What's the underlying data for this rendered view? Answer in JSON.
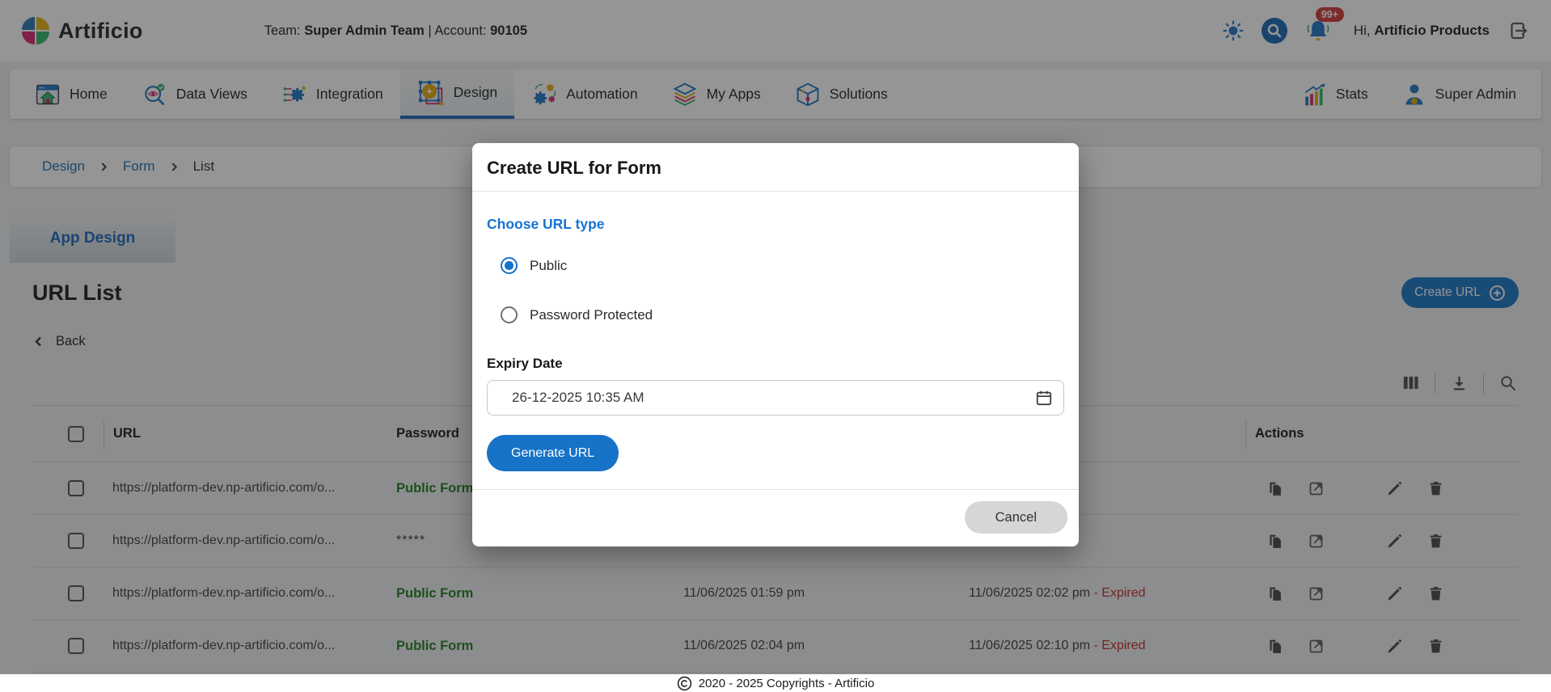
{
  "header": {
    "brand": "Artificio",
    "team_label": "Team:",
    "team_name": "Super Admin Team",
    "account_label": "| Account:",
    "account_value": "90105",
    "notification_badge": "99+",
    "greeting_label": "Hi,",
    "user_name": "Artificio Products"
  },
  "nav": {
    "items": [
      {
        "label": "Home",
        "icon": "home-icon",
        "active": false
      },
      {
        "label": "Data Views",
        "icon": "data-views-icon",
        "active": false
      },
      {
        "label": "Integration",
        "icon": "integration-icon",
        "active": false
      },
      {
        "label": "Design",
        "icon": "design-icon",
        "active": true
      },
      {
        "label": "Automation",
        "icon": "automation-icon",
        "active": false
      },
      {
        "label": "My Apps",
        "icon": "my-apps-icon",
        "active": false
      },
      {
        "label": "Solutions",
        "icon": "solutions-icon",
        "active": false
      }
    ],
    "right_items": [
      {
        "label": "Stats",
        "icon": "stats-icon"
      },
      {
        "label": "Super Admin",
        "icon": "super-admin-icon"
      }
    ]
  },
  "breadcrumb": {
    "items": [
      "Design",
      "Form",
      "List"
    ]
  },
  "page": {
    "tab_label": "App Design",
    "title": "URL List",
    "create_url_label": "Create URL",
    "back_label": "Back"
  },
  "table": {
    "headers": {
      "url": "URL",
      "password": "Password",
      "actions": "Actions"
    },
    "rows": [
      {
        "url": "https://platform-dev.np-artificio.com/o...",
        "password": "Public Form",
        "created": "",
        "expiry": "",
        "status": ""
      },
      {
        "url": "https://platform-dev.np-artificio.com/o...",
        "password": "*****",
        "created": "",
        "expiry": "",
        "status": ""
      },
      {
        "url": "https://platform-dev.np-artificio.com/o...",
        "password": "Public Form",
        "created": "11/06/2025 01:59 pm",
        "expiry": "11/06/2025 02:02 pm",
        "status": "- Expired"
      },
      {
        "url": "https://platform-dev.np-artificio.com/o...",
        "password": "Public Form",
        "created": "11/06/2025 02:04 pm",
        "expiry": "11/06/2025 02:10 pm",
        "status": "- Expired"
      }
    ]
  },
  "modal": {
    "title": "Create URL for Form",
    "choose_url_type_label": "Choose URL type",
    "options": [
      {
        "label": "Public",
        "selected": true
      },
      {
        "label": "Password Protected",
        "selected": false
      }
    ],
    "expiry_date_label": "Expiry Date",
    "expiry_date_value": "26-12-2025 10:35 AM",
    "generate_button_label": "Generate URL",
    "cancel_button_label": "Cancel"
  },
  "footer": {
    "copyright_text": "2020 - 2025 Copyrights - Artificio"
  },
  "colors": {
    "accent_blue": "#1673c7",
    "link_blue": "#1a6fb5",
    "active_tab_underline": "#1565c0",
    "success_green": "#1e7d1e",
    "error_red": "#c62828",
    "badge_red": "#d03737"
  },
  "icons": [
    "artificio-logo-icon",
    "theme-sun-icon",
    "search-icon",
    "notifications-bell-icon",
    "logout-icon",
    "home-icon",
    "data-views-icon",
    "integration-icon",
    "design-icon",
    "automation-icon",
    "my-apps-icon",
    "solutions-icon",
    "stats-icon",
    "super-admin-icon",
    "chevron-right-icon",
    "chevron-left-icon",
    "plus-circle-icon",
    "columns-icon",
    "download-icon",
    "copy-icon",
    "open-in-new-icon",
    "edit-icon",
    "delete-icon",
    "calendar-icon",
    "copyright-icon"
  ]
}
